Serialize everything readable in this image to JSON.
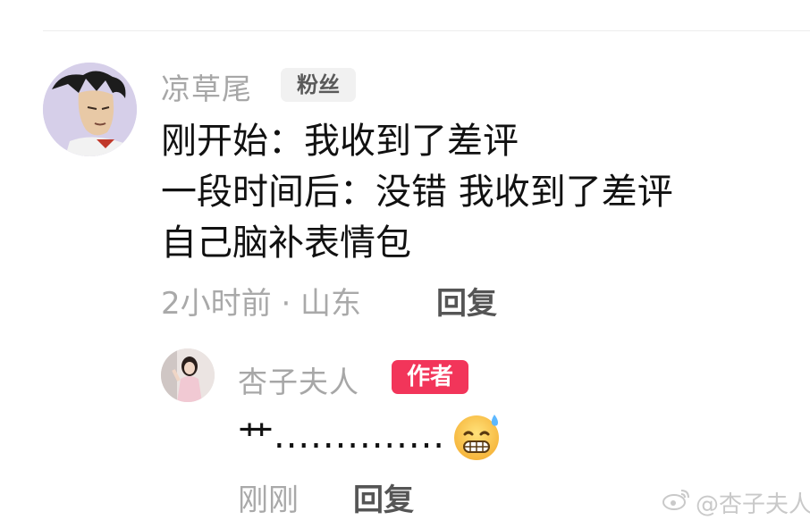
{
  "comment": {
    "username": "凉草尾",
    "badge": "粉丝",
    "lines": [
      "刚开始：我收到了差评",
      "一段时间后：没错 我收到了差评",
      "自己脑补表情包"
    ],
    "meta": "2小时前 · 山东",
    "reply_label": "回复"
  },
  "reply": {
    "username": "杏子夫人",
    "badge": "作者",
    "text": "艹",
    "dots": "..............",
    "emoji": "grinning-sweat-emoji",
    "meta": "刚刚",
    "reply_label": "回复"
  },
  "watermark": {
    "text": "@杏子夫人",
    "icon": "weibo-icon"
  },
  "colors": {
    "author_badge": "#f2355a",
    "fan_badge_bg": "#f1f1f1",
    "meta_gray": "#a9a9a9"
  }
}
